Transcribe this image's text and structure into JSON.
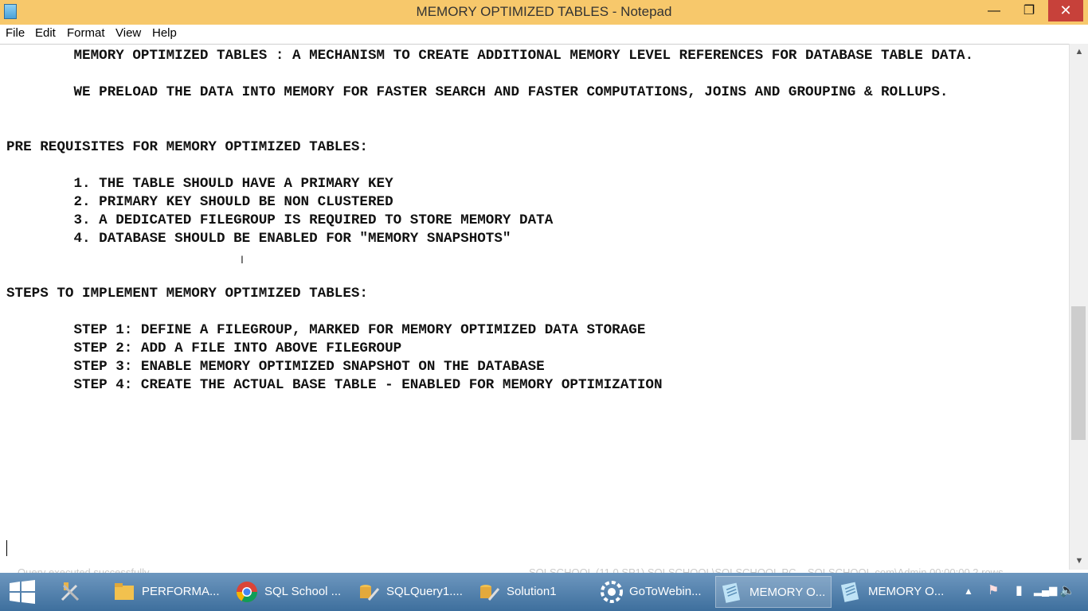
{
  "window": {
    "title": "MEMORY OPTIMIZED TABLES - Notepad",
    "minimize_glyph": "—",
    "maximize_glyph": "❐",
    "close_glyph": "✕",
    "app_icon": "notepad-icon"
  },
  "menu": [
    "File",
    "Edit",
    "Format",
    "View",
    "Help"
  ],
  "document": {
    "lines": [
      "        MEMORY OPTIMIZED TABLES : A MECHANISM TO CREATE ADDITIONAL MEMORY LEVEL REFERENCES FOR DATABASE TABLE DATA.",
      "",
      "        WE PRELOAD THE DATA INTO MEMORY FOR FASTER SEARCH AND FASTER COMPUTATIONS, JOINS AND GROUPING & ROLLUPS.",
      "",
      "",
      "PRE REQUISITES FOR MEMORY OPTIMIZED TABLES:",
      "",
      "        1. THE TABLE SHOULD HAVE A PRIMARY KEY",
      "        2. PRIMARY KEY SHOULD BE NON CLUSTERED",
      "        3. A DEDICATED FILEGROUP IS REQUIRED TO STORE MEMORY DATA",
      "        4. DATABASE SHOULD BE ENABLED FOR \"MEMORY SNAPSHOTS\"",
      "",
      "",
      "STEPS TO IMPLEMENT MEMORY OPTIMIZED TABLES:",
      "",
      "        STEP 1: DEFINE A FILEGROUP, MARKED FOR MEMORY OPTIMIZED DATA STORAGE",
      "        STEP 2: ADD A FILE INTO ABOVE FILEGROUP",
      "        STEP 3: ENABLE MEMORY OPTIMIZED SNAPSHOT ON THE DATABASE",
      "        STEP 4: CREATE THE ACTUAL BASE TABLE - ENABLED FOR MEMORY OPTIMIZATION"
    ]
  },
  "scrollbar": {
    "up_glyph": "▲",
    "down_glyph": "▼"
  },
  "background_status": {
    "left": "Query executed successfully.",
    "right": "SQLSCHOOL (11.0 SP1)   SQLSCHOOL\\SQLSCHOOL PC...   SQLSCHOOL.com\\Admin   00:00:00   2 rows"
  },
  "taskbar": {
    "tasks": [
      {
        "label": "PERFORMA...",
        "icon": "folder-icon"
      },
      {
        "label": "SQL School ...",
        "icon": "chrome-icon"
      },
      {
        "label": "SQLQuery1....",
        "icon": "ssms-icon"
      },
      {
        "label": "Solution1",
        "icon": "ssms-icon"
      },
      {
        "label": "GoToWebin...",
        "icon": "gotowebinar-icon"
      },
      {
        "label": "MEMORY O...",
        "icon": "notepad-icon"
      },
      {
        "label": "MEMORY O...",
        "icon": "notepad-icon"
      }
    ],
    "tray": {
      "up_arrow": "▲",
      "flag": "⚑",
      "battery": "▮",
      "signal": "▂▄▆",
      "volume": "🔈"
    },
    "colors": {
      "accent": "#f7c86b",
      "taskbar": "#4a7aa8",
      "close": "#c7413a"
    }
  }
}
